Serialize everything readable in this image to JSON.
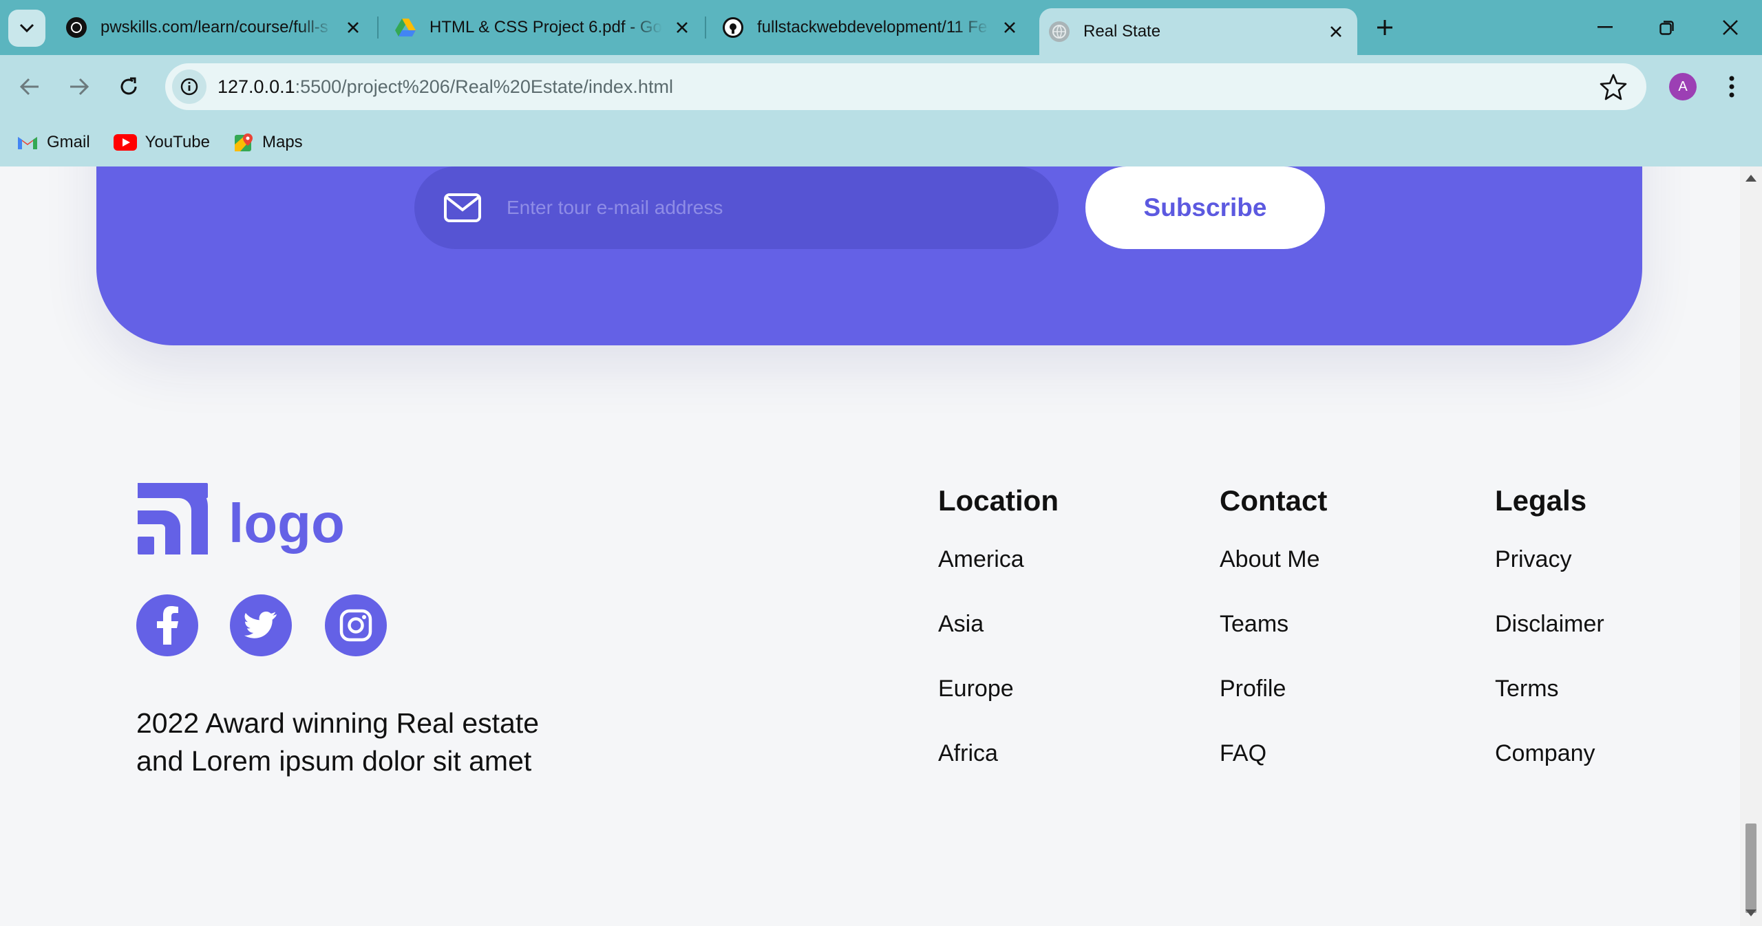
{
  "browser": {
    "tabs": [
      {
        "title": "pwskills.com/learn/course/full-s",
        "active": false
      },
      {
        "title": "HTML & CSS Project 6.pdf - Goo",
        "active": false
      },
      {
        "title": "fullstackwebdevelopment/11 Fe",
        "active": false
      },
      {
        "title": "Real State",
        "active": true
      }
    ],
    "url_host": "127.0.0.1",
    "url_path": ":5500/project%206/Real%20Estate/index.html",
    "profile_initial": "A",
    "bookmarks": [
      {
        "label": "Gmail",
        "icon": "gmail-icon"
      },
      {
        "label": "YouTube",
        "icon": "youtube-icon"
      },
      {
        "label": "Maps",
        "icon": "maps-icon"
      }
    ]
  },
  "newsletter": {
    "email_placeholder": "Enter tour e-mail address",
    "subscribe_label": "Subscribe"
  },
  "footer": {
    "logo_text": "logo",
    "social": [
      "facebook-icon",
      "twitter-icon",
      "instagram-icon"
    ],
    "tagline": "2022 Award winning Real estate and Lorem ipsum dolor sit amet",
    "columns": [
      {
        "heading": "Location",
        "links": [
          "America",
          "Asia",
          "Europe",
          "Africa"
        ]
      },
      {
        "heading": "Contact",
        "links": [
          "About Me",
          "Teams",
          "Profile",
          "FAQ"
        ]
      },
      {
        "heading": "Legals",
        "links": [
          "Privacy",
          "Disclaimer",
          "Terms",
          "Company"
        ]
      }
    ]
  },
  "colors": {
    "accent": "#6461e6",
    "tabstrip": "#5bb5bf",
    "toolbar": "#b9dfe5"
  }
}
